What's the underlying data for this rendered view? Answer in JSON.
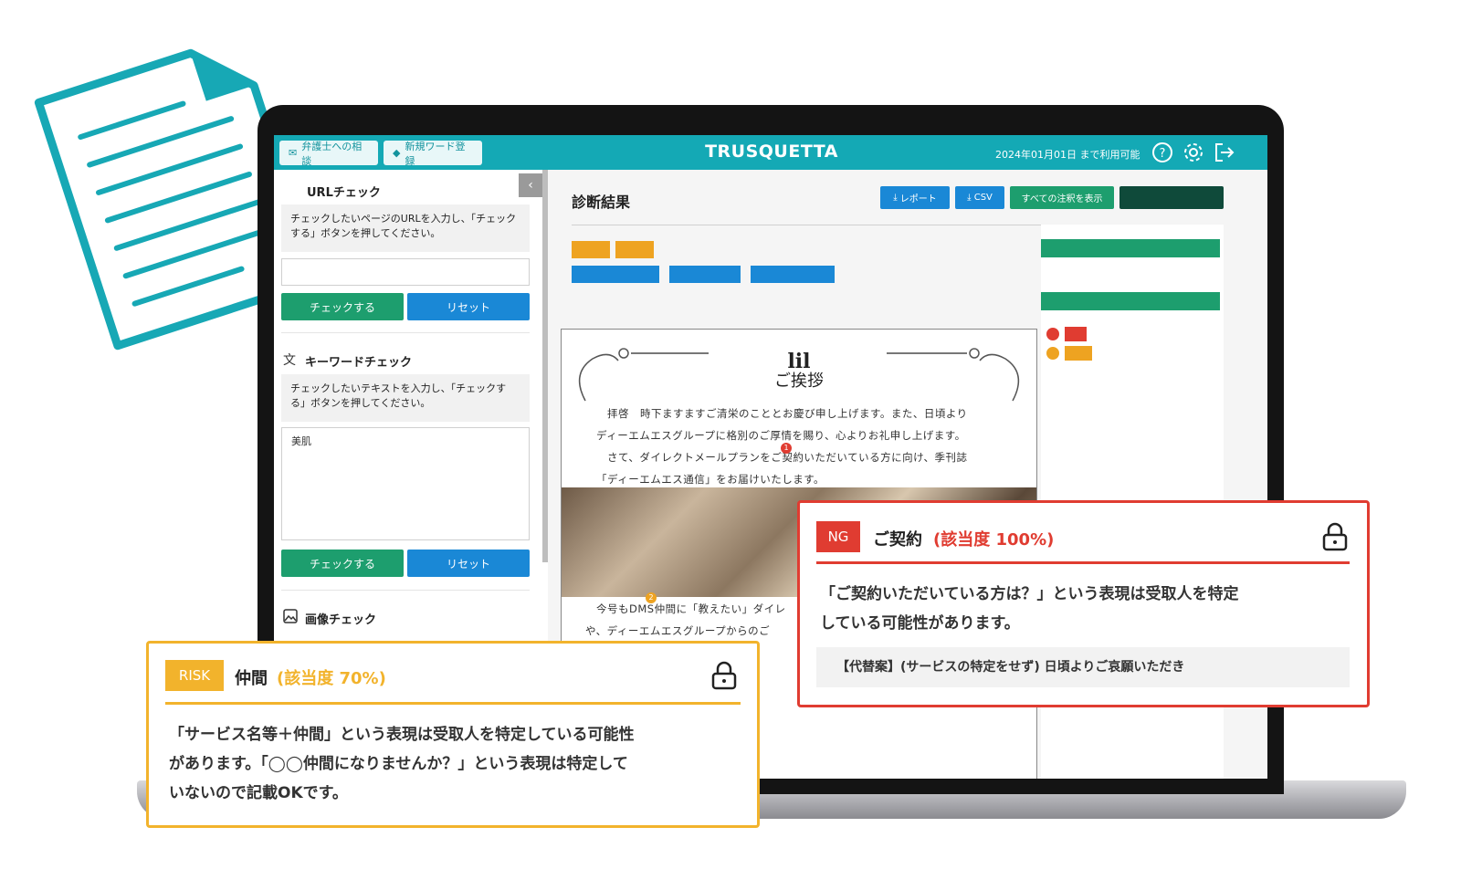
{
  "header": {
    "consult_label": "弁護士への相談",
    "register_label": "新規ワード登録",
    "brand": "TRUSQUETTA",
    "expiry": "2024年01月01日 まで利用可能"
  },
  "sidebar": {
    "url_check": {
      "title": "URLチェック",
      "desc": "チェックしたいページのURLを入力し、「チェックする」ボタンを押してください。",
      "input_value": "",
      "check_label": "チェックする",
      "reset_label": "リセット"
    },
    "keyword_check": {
      "title": "キーワードチェック",
      "desc": "チェックしたいテキストを入力し、「チェックする」ボタンを押してください。",
      "textarea_value": "美肌",
      "check_label": "チェックする",
      "reset_label": "リセット"
    },
    "image_check": {
      "title": "画像チェック"
    }
  },
  "main": {
    "result_title": "診断結果",
    "report_label": "レポート",
    "csv_label": "CSV",
    "show_all_label": "すべての注釈を表示",
    "doc": {
      "title": "ご挨拶",
      "lines": [
        "拝啓　時下ますますご清栄のこととお慶び申し上げます。また、日頃より",
        "ディーエムエスグループに格別のご厚情を賜り、心よりお礼申し上げます。",
        "さて、ダイレクトメールプランをご契約いただいている方に向け、季刊誌",
        "「ディーエムエス通信」をお届けいたします。"
      ],
      "lower_lines": [
        "今号もDMS仲間に「教えたい」ダイレ",
        "や、ディーエムエスグループからのご"
      ],
      "marker1": "1",
      "marker2": "2"
    }
  },
  "popups": {
    "ng": {
      "badge": "NG",
      "term": "ご契約",
      "score": "(該当度 100%)",
      "text_line1": "「ご契約いただいている方は？」という表現は受取人を特定",
      "text_line2": "している可能性があります。",
      "alternative": "【代替案】(サービスの特定をせず) 日頃よりご哀願いただき"
    },
    "risk": {
      "badge": "RISK",
      "term": "仲間",
      "score": "(該当度 70%)",
      "text_line1": "「サービス名等＋仲間」という表現は受取人を特定している可能性",
      "text_line2": "があります。「◯◯仲間になりませんか？」という表現は特定して",
      "text_line3": "いないので記載OKです。"
    }
  },
  "colors": {
    "header": "#14a9b5",
    "ng": "#e03c31",
    "risk": "#f2b32c",
    "green_button": "#1d9e6e",
    "blue_button": "#1a88d6"
  },
  "icons": [
    "document-icon",
    "help-icon",
    "settings-icon",
    "logout-icon",
    "lock-icon",
    "download-icon",
    "translate-icon",
    "image-icon"
  ]
}
